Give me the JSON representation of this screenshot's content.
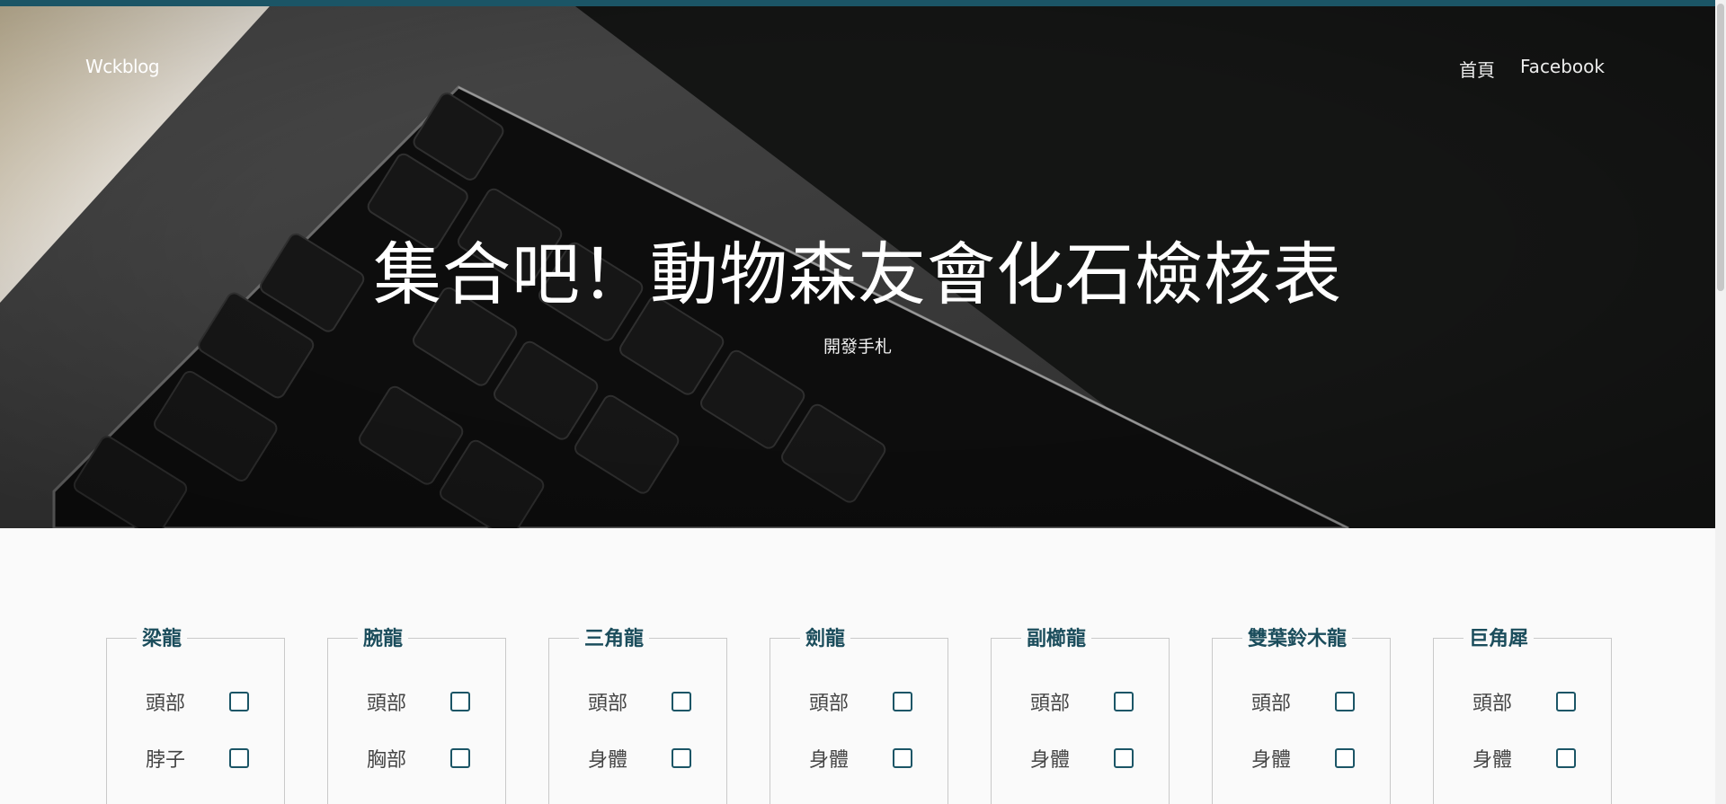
{
  "brand": "Wckblog",
  "nav": {
    "items": [
      {
        "label": "首頁"
      },
      {
        "label": "Facebook"
      }
    ]
  },
  "hero": {
    "title": "集合吧！動物森友會化石檢核表",
    "subtitle": "開發手札"
  },
  "colors": {
    "accent": "#1b5566",
    "card_title": "#1b4d5c"
  },
  "fossils": [
    {
      "name": "梁龍",
      "parts": [
        {
          "label": "頭部",
          "checked": false
        },
        {
          "label": "脖子",
          "checked": false
        }
      ]
    },
    {
      "name": "腕龍",
      "parts": [
        {
          "label": "頭部",
          "checked": false
        },
        {
          "label": "胸部",
          "checked": false
        }
      ]
    },
    {
      "name": "三角龍",
      "parts": [
        {
          "label": "頭部",
          "checked": false
        },
        {
          "label": "身體",
          "checked": false
        }
      ]
    },
    {
      "name": "劍龍",
      "parts": [
        {
          "label": "頭部",
          "checked": false
        },
        {
          "label": "身體",
          "checked": false
        }
      ]
    },
    {
      "name": "副櫛龍",
      "parts": [
        {
          "label": "頭部",
          "checked": false
        },
        {
          "label": "身體",
          "checked": false
        }
      ]
    },
    {
      "name": "雙葉鈴木龍",
      "parts": [
        {
          "label": "頭部",
          "checked": false
        },
        {
          "label": "身體",
          "checked": false
        }
      ]
    },
    {
      "name": "巨角犀",
      "parts": [
        {
          "label": "頭部",
          "checked": false
        },
        {
          "label": "身體",
          "checked": false
        }
      ]
    }
  ]
}
